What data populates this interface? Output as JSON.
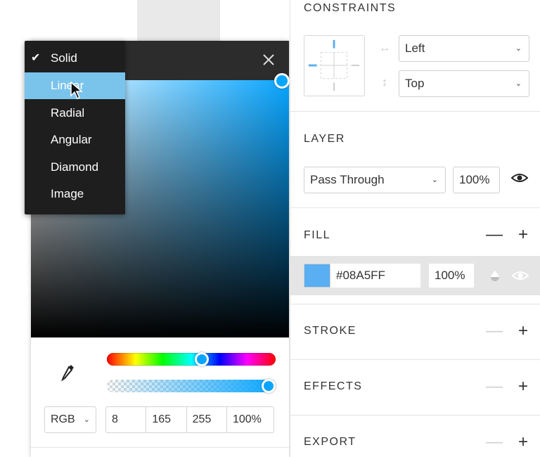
{
  "color_picker": {
    "gradient_types": [
      "Solid",
      "Linear",
      "Radial",
      "Angular",
      "Diamond",
      "Image"
    ],
    "selected_type": "Solid",
    "hovered_type": "Linear",
    "color_model": "RGB",
    "r": "8",
    "g": "165",
    "b": "255",
    "alpha": "100%",
    "hue_position": 0.57,
    "alpha_position": 1.0,
    "color": "#08A5FF"
  },
  "panel": {
    "constraints": {
      "title": "CONSTRAINTS",
      "horizontal": "Left",
      "vertical": "Top"
    },
    "layer": {
      "title": "LAYER",
      "blend_mode": "Pass Through",
      "opacity": "100%"
    },
    "fill": {
      "title": "FILL",
      "hex": "#08A5FF",
      "opacity": "100%",
      "swatch_color": "#5AAEF2"
    },
    "stroke": {
      "title": "STROKE"
    },
    "effects": {
      "title": "EFFECTS"
    },
    "export": {
      "title": "EXPORT"
    }
  }
}
